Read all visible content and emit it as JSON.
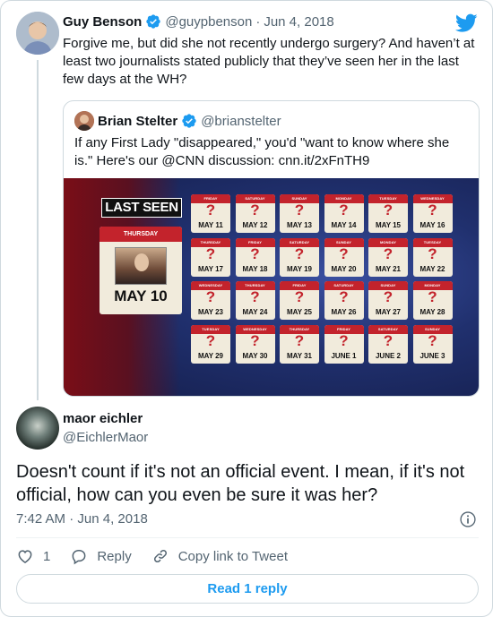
{
  "tweet": {
    "author_name": "Guy Benson",
    "author_handle": "@guypbenson",
    "date": "Jun 4, 2018",
    "text": "Forgive me, but did she not recently undergo surgery? And haven’t at least two journalists stated publicly that they’ve seen her in the last few days at the WH?"
  },
  "quote": {
    "author_name": "Brian Stelter",
    "author_handle": "@brianstelter",
    "text": "If any First Lady \"disappeared,\" you'd \"want to know where she is.\" Here's our @CNN discussion: cnn.it/2xFnTH9",
    "media": {
      "banner": "LAST SEEN",
      "big_day": "THURSDAY",
      "big_date": "MAY 10",
      "calendar_days": [
        {
          "day": "FRIDAY",
          "date": "MAY 11"
        },
        {
          "day": "SATURDAY",
          "date": "MAY 12"
        },
        {
          "day": "SUNDAY",
          "date": "MAY 13"
        },
        {
          "day": "MONDAY",
          "date": "MAY 14"
        },
        {
          "day": "TUESDAY",
          "date": "MAY 15"
        },
        {
          "day": "WEDNESDAY",
          "date": "MAY 16"
        },
        {
          "day": "THURSDAY",
          "date": "MAY 17"
        },
        {
          "day": "FRIDAY",
          "date": "MAY 18"
        },
        {
          "day": "SATURDAY",
          "date": "MAY 19"
        },
        {
          "day": "SUNDAY",
          "date": "MAY 20"
        },
        {
          "day": "MONDAY",
          "date": "MAY 21"
        },
        {
          "day": "TUESDAY",
          "date": "MAY 22"
        },
        {
          "day": "WEDNESDAY",
          "date": "MAY 23"
        },
        {
          "day": "THURSDAY",
          "date": "MAY 24"
        },
        {
          "day": "FRIDAY",
          "date": "MAY 25"
        },
        {
          "day": "SATURDAY",
          "date": "MAY 26"
        },
        {
          "day": "SUNDAY",
          "date": "MAY 27"
        },
        {
          "day": "MONDAY",
          "date": "MAY 28"
        },
        {
          "day": "TUESDAY",
          "date": "MAY 29"
        },
        {
          "day": "WEDNESDAY",
          "date": "MAY 30"
        },
        {
          "day": "THURSDAY",
          "date": "MAY 31"
        },
        {
          "day": "FRIDAY",
          "date": "JUNE 1"
        },
        {
          "day": "SATURDAY",
          "date": "JUNE 2"
        },
        {
          "day": "SUNDAY",
          "date": "JUNE 3"
        }
      ],
      "unknown_mark": "?"
    }
  },
  "reply": {
    "author_name": "maor eichler",
    "author_handle": "@EichlerMaor",
    "text": "Doesn't count if it's not an official event. I mean, if it's not official, how can you even be sure it was her?",
    "time": "7:42 AM",
    "separator": "·",
    "date": "Jun 4, 2018",
    "like_count": "1",
    "reply_label": "Reply",
    "copy_link_label": "Copy link to Tweet",
    "read_replies_label": "Read 1 reply"
  },
  "icons": {
    "verified": "verified-badge-icon",
    "brand": "twitter-bird-icon",
    "like": "heart-icon",
    "reply": "speech-bubble-icon",
    "link": "link-icon",
    "info": "info-icon"
  },
  "colors": {
    "accent": "#1d9bf0",
    "text_primary": "#0f1419",
    "text_secondary": "#536471",
    "border": "#cfd9de",
    "calendar_red": "#c3232c"
  }
}
